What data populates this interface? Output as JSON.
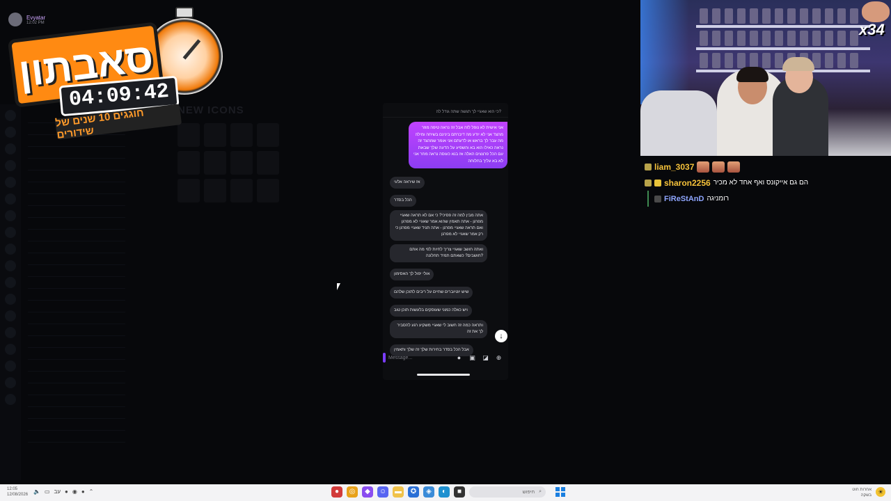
{
  "overlay": {
    "author_name": "Evyatar",
    "author_time": "12:02 PM",
    "stream_title": "סאבתון",
    "timer": "04:09:42",
    "tagline": "חוגגים 10 שנים של שידורים"
  },
  "background": {
    "panel_label": "NEW ICONS"
  },
  "phone": {
    "reply_preview": "כי הוא שאגיי לך תגשה שתה גודל לה?",
    "sent_message": "אני אישית לא נופל לזה אבל זה נראה טיפה מוזר מהצד אני לא יודע מה דיברתם בינינם בשיחה ומילה מה עבר לך בראש או לדעתם אני אומר שמהצד זה נראה כאילו הוא בא והשפיע על הדעה שלך שבאת עם הכל פרצצים האלה אז בנא כעוסה נראה מחר אני לא בא עליך בחלוחה",
    "received_messages": [
      "אז שיראה אלעי",
      "הכל בסדר",
      "אתה מבין למה זה פסיכי? כי אם לא תראה שאגיי מפרגן - אתה תאמין שהוא אמר שאגיי לא מפרגן ואם תראה שאגיי מפרגן - אתה תגיד שאגיי מפרגן כי רק אמר שאגיי לא מפרגן",
      "ואתה חושב שאגיי צריך לחיות לפי מה אתם חושבים? כשאתם תמיד תחלונה?",
      "אולי יפול לך האסימון",
      "שיש יוטיוברים שחיים על ריבים לתוכן שלהם",
      "ויש כאלה כמוני שעוסקים בלעשות תוכן טוב",
      "ותראה כמה זה חשוב לי שאגיי משקיע רגע להסביר לך את זה",
      "אבל הכל בסדר בחירות שלך זה שלך ותאמין"
    ],
    "composer_placeholder": "Message...",
    "scroll_icon": "↓",
    "icons": [
      "mic-icon",
      "image-icon",
      "sticker-icon",
      "plus-icon"
    ]
  },
  "webcam": {
    "multiplier": "x34"
  },
  "chat": {
    "messages": [
      {
        "user": "liam_3037",
        "user_color": "#f6c23a",
        "text": "",
        "emotes": 3
      },
      {
        "user": "sharon2256",
        "user_color": "#f6c23a",
        "text": "הם גם אייקונס ואף אחד לא מכיר",
        "emotes": 0
      },
      {
        "user": "FiReStAnD",
        "user_color": "#8fa6ff",
        "text": "רומניגה",
        "emotes": 0
      }
    ]
  },
  "taskbar": {
    "clock_time": "12:05",
    "clock_date": "12/08/2026",
    "lang": "עב",
    "search_placeholder": "חיפוש",
    "right_line1": "אחרות חוט",
    "right_line2": "בשקה"
  }
}
